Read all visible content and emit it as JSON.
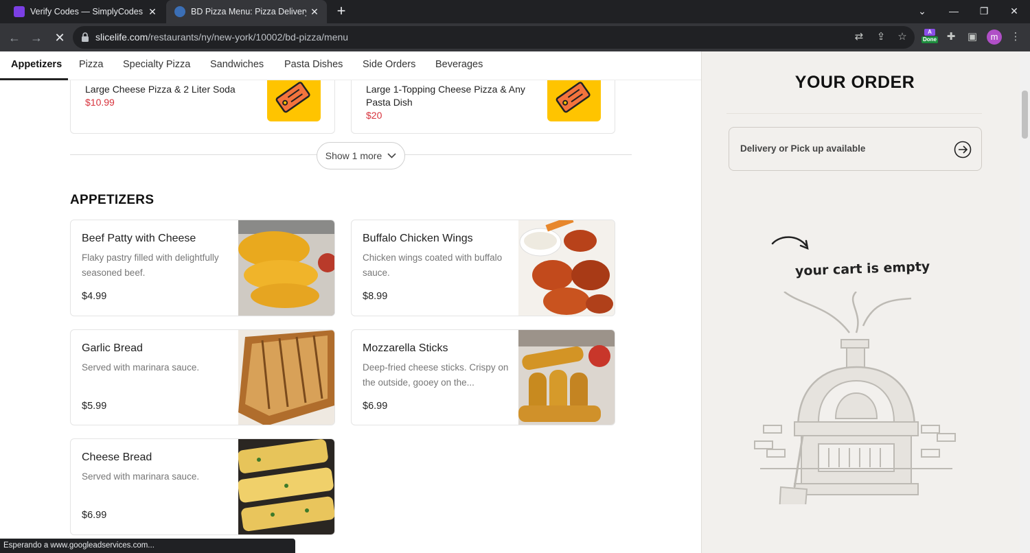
{
  "browser": {
    "tabs": [
      {
        "title": "Verify Codes — SimplyCodes",
        "active": false
      },
      {
        "title": "BD Pizza Menu: Pizza Delivery New York",
        "active": true
      }
    ],
    "url_host": "slicelife.com",
    "url_path": "/restaurants/ny/new-york/10002/bd-pizza/menu",
    "extension_badge": "Done",
    "extension_letter": "A",
    "profile_initial": "m",
    "status_text": "Esperando a www.googleadservices.com..."
  },
  "categories": [
    "Appetizers",
    "Pizza",
    "Specialty Pizza",
    "Sandwiches",
    "Pasta Dishes",
    "Side Orders",
    "Beverages"
  ],
  "promos": [
    {
      "title": "Large Cheese Pizza & 2 Liter Soda",
      "price": "$10.99"
    },
    {
      "title": "Large 1-Topping Cheese Pizza & Any Pasta Dish",
      "price": "$20"
    }
  ],
  "show_more_label": "Show 1 more",
  "section_title": "APPETIZERS",
  "items": [
    {
      "name": "Beef Patty with Cheese",
      "desc": "Flaky pastry filled with delightfully seasoned beef.",
      "price": "$4.99"
    },
    {
      "name": "Buffalo Chicken Wings",
      "desc": "Chicken wings coated with buffalo sauce.",
      "price": "$8.99"
    },
    {
      "name": "Garlic Bread",
      "desc": "Served with marinara sauce.",
      "price": "$5.99"
    },
    {
      "name": "Mozzarella Sticks",
      "desc": "Deep-fried cheese sticks. Crispy on the outside, gooey on the...",
      "price": "$6.99"
    },
    {
      "name": "Cheese Bread",
      "desc": "Served with marinara sauce.",
      "price": "$6.99"
    }
  ],
  "order": {
    "title": "YOUR ORDER",
    "delivery_text": "Delivery or Pick up available",
    "empty_text": "your cart is empty"
  },
  "colors": {
    "price_red": "#d7313b",
    "promo_yellow": "#ffc400",
    "panel_bg": "#f2f0ed"
  }
}
